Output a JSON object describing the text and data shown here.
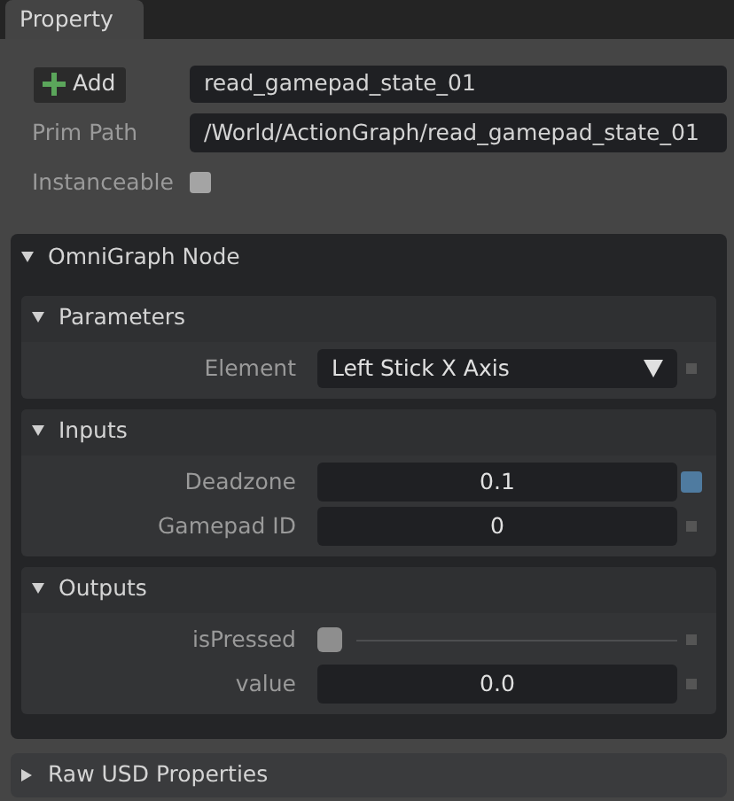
{
  "tab": {
    "label": "Property",
    "selected": true
  },
  "prim": {
    "add_button": "Add",
    "name_field": "read_gamepad_state_01",
    "rows": [
      {
        "label": "Prim Path",
        "kind": "text",
        "value": "/World/ActionGraph/read_gamepad_state_01"
      },
      {
        "label": "Instanceable",
        "kind": "checkbox",
        "checked": false
      }
    ]
  },
  "node_section": {
    "title": "OmniGraph Node",
    "expanded": true,
    "groups": [
      {
        "title": "Parameters",
        "expanded": true,
        "fields": [
          {
            "label": "Element",
            "kind": "dropdown",
            "value": "Left Stick X Axis",
            "modified": false
          }
        ]
      },
      {
        "title": "Inputs",
        "expanded": true,
        "fields": [
          {
            "label": "Deadzone",
            "kind": "number",
            "value": "0.1",
            "modified": true
          },
          {
            "label": "Gamepad ID",
            "kind": "number",
            "value": "0",
            "modified": false
          }
        ]
      },
      {
        "title": "Outputs",
        "expanded": true,
        "fields": [
          {
            "label": "isPressed",
            "kind": "bool",
            "checked": false,
            "modified": false
          },
          {
            "label": "value",
            "kind": "number",
            "value": "0.0",
            "modified": false
          }
        ]
      }
    ]
  },
  "raw_section": {
    "title": "Raw USD Properties",
    "expanded": false
  }
}
